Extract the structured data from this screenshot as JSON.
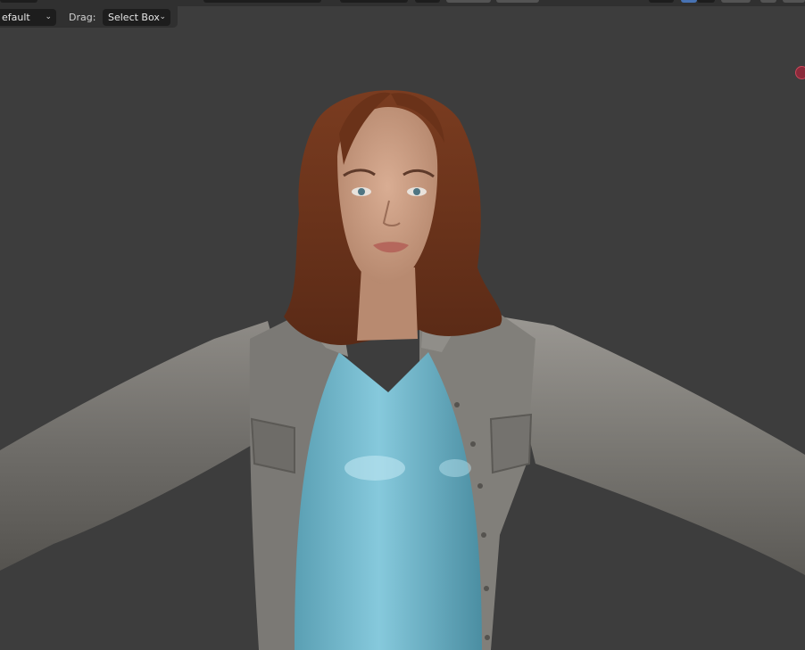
{
  "toolbar": {
    "transform_orientation_value": "efault",
    "drag_label": "Drag:",
    "drag_value": "Select Box"
  },
  "icons": {
    "dropdown_chevron": "chevron-down-icon",
    "axis_gizmo": "gizmo-x-axis-icon"
  },
  "viewport": {
    "content": "3d-character-model"
  },
  "colors": {
    "viewport_bg": "#3d3d3d",
    "header_bg": "#303030",
    "widget_bg": "#1d1d1d",
    "accent_blue": "#4772b3",
    "gizmo_red": "#d0455a"
  }
}
